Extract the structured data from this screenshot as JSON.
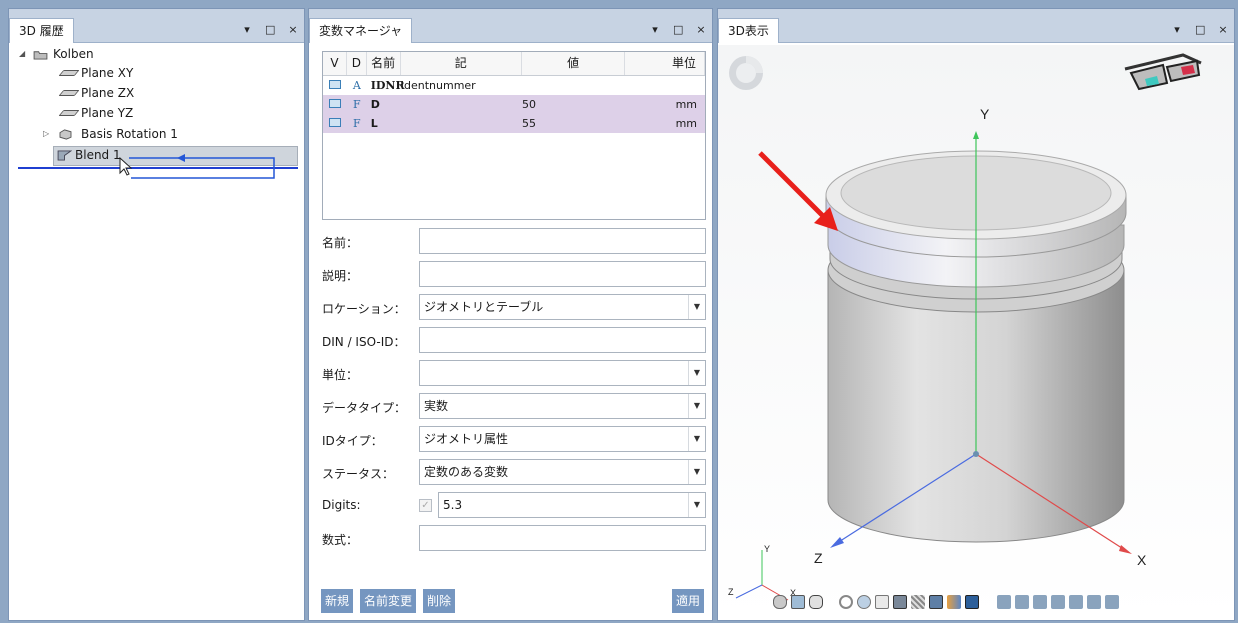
{
  "history_panel": {
    "tab": "3D 履歴",
    "controls": [
      "▾",
      "□",
      "×"
    ],
    "tree": [
      {
        "label": "Kolben"
      },
      {
        "label": "Plane XY"
      },
      {
        "label": "Plane ZX"
      },
      {
        "label": "Plane YZ"
      },
      {
        "label": "Basis Rotation 1"
      },
      {
        "label": "Blend 1"
      }
    ]
  },
  "variable_panel": {
    "tab": "変数マネージャ",
    "controls": [
      "▾",
      "□",
      "×"
    ],
    "columns": [
      "V",
      "D",
      "名前",
      "記",
      "値",
      "単位"
    ],
    "rows": [
      {
        "d": "A",
        "name": "IDNR",
        "desc": "Identnummer",
        "value": "",
        "unit": ""
      },
      {
        "d": "F",
        "name": "D",
        "desc": "",
        "value": "50",
        "unit": "mm"
      },
      {
        "d": "F",
        "name": "L",
        "desc": "",
        "value": "55",
        "unit": "mm"
      }
    ],
    "form": {
      "name_label": "名前：",
      "name_value": "",
      "desc_label": "説明：",
      "desc_value": "",
      "location_label": "ロケーション：",
      "location_value": "ジオメトリとテーブル",
      "din_label": "DIN / ISO-ID：",
      "din_value": "",
      "unit_label": "単位：",
      "unit_value": "",
      "datatype_label": "データタイプ：",
      "datatype_value": "実数",
      "idtype_label": "IDタイプ：",
      "idtype_value": "ジオメトリ属性",
      "status_label": "ステータス：",
      "status_value": "定数のある変数",
      "digits_label": "Digits:",
      "digits_value": "5.3",
      "formula_label": "数式：",
      "formula_value": ""
    },
    "buttons": {
      "new": "新規",
      "rename": "名前変更",
      "delete": "削除",
      "apply": "適用"
    }
  },
  "view_panel": {
    "tab": "3D表示",
    "controls": [
      "▾",
      "□",
      "×"
    ],
    "axis_y": "Y",
    "axis_x": "X",
    "axis_z": "Z",
    "mini_y": "Y",
    "mini_x": "X",
    "mini_z": "Z"
  }
}
